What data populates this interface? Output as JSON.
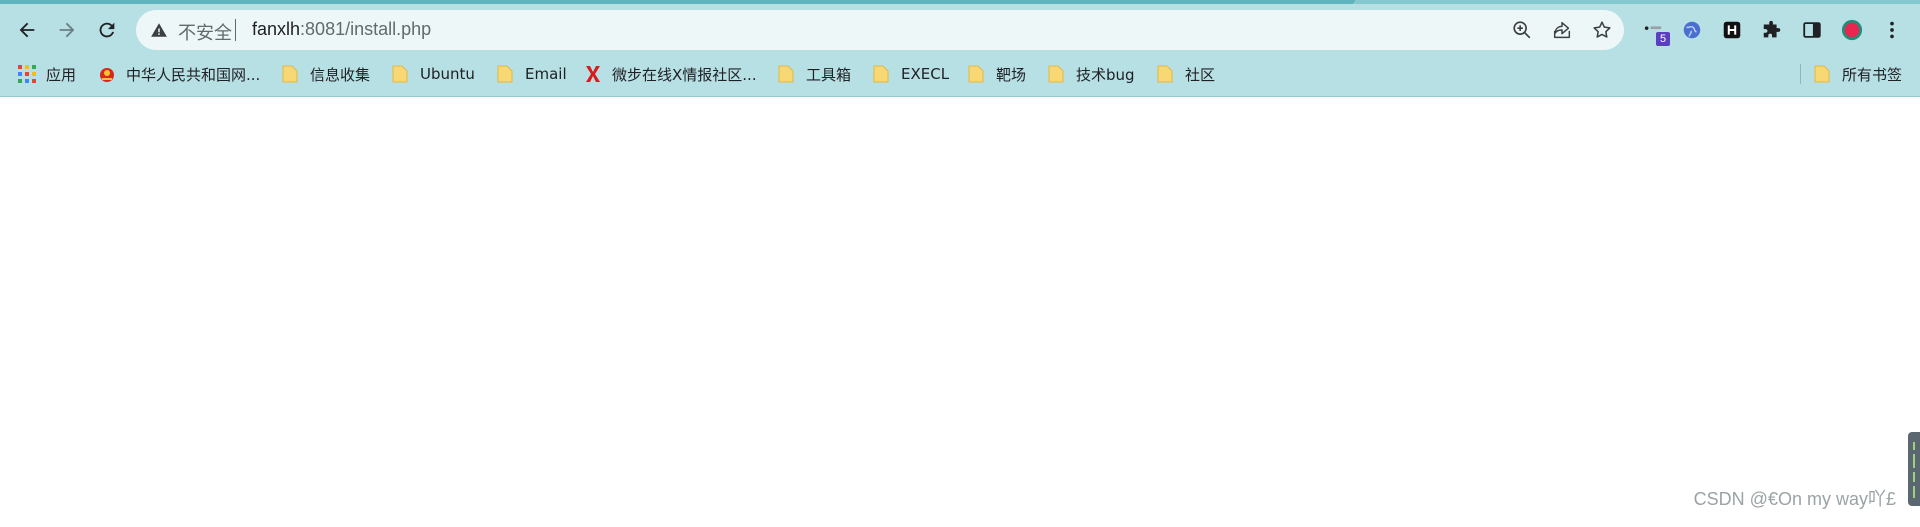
{
  "toolbar": {
    "back_icon": "back-arrow-icon",
    "forward_icon": "forward-arrow-icon",
    "reload_icon": "reload-icon"
  },
  "omnibox": {
    "security_label": "不安全",
    "url_host": "fanxlh",
    "url_rest": ":8081/install.php",
    "actions": [
      "zoom-icon",
      "share-icon",
      "bookmark-star-icon"
    ]
  },
  "extensions": {
    "badge_count": "5",
    "h_label": "H"
  },
  "bookmarks": {
    "apps_label": "应用",
    "items": [
      {
        "label": "中华人民共和国网..."
      },
      {
        "label": "信息收集"
      },
      {
        "label": "Ubuntu"
      },
      {
        "label": "Email"
      },
      {
        "label": "微步在线X情报社区..."
      },
      {
        "label": "工具箱"
      },
      {
        "label": "EXECL"
      },
      {
        "label": "靶场"
      },
      {
        "label": "技术bug"
      },
      {
        "label": "社区"
      }
    ],
    "all_bookmarks_label": "所有书签"
  },
  "watermark": "CSDN @€On my way吖£",
  "colors": {
    "chrome": "#b7e0e5",
    "omnibox": "#eef7f8",
    "folder": "#f7d874",
    "page": "#ffffff"
  }
}
